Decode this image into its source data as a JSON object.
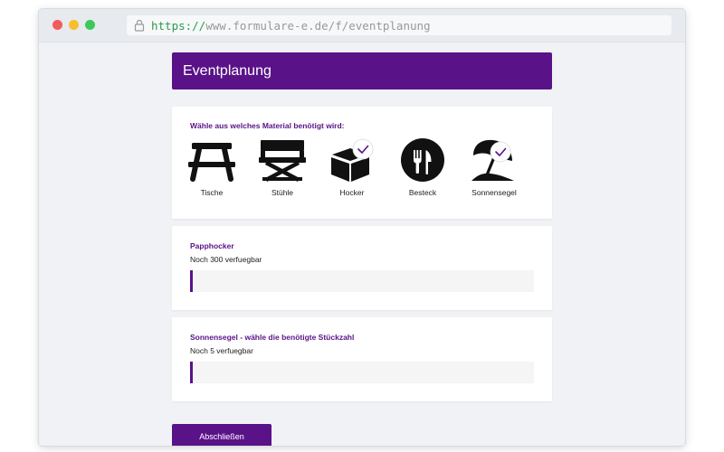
{
  "browser": {
    "url_scheme": "https://",
    "url_rest": "www.formulare-e.de/f/eventplanung"
  },
  "form": {
    "title": "Eventplanung",
    "material_label": "Wähle aus welches Material benötigt wird:",
    "materials": [
      {
        "label": "Tische",
        "icon": "picnic-table-icon",
        "selected": false
      },
      {
        "label": "Stühle",
        "icon": "director-chair-icon",
        "selected": false
      },
      {
        "label": "Hocker",
        "icon": "box-stool-icon",
        "selected": true
      },
      {
        "label": "Besteck",
        "icon": "cutlery-icon",
        "selected": false
      },
      {
        "label": "Sonnensegel",
        "icon": "beach-umbrella-icon",
        "selected": true
      }
    ],
    "papphocker": {
      "label": "Papphocker",
      "availability": "Noch 300 verfuegbar",
      "value": ""
    },
    "sonnensegel": {
      "label": "Sonnensegel - wähle die benötigte Stückzahl",
      "availability": "Noch 5 verfuegbar",
      "value": ""
    },
    "submit_label": "Abschließen"
  },
  "colors": {
    "accent": "#5a1288",
    "url_scheme": "#2d9a4e"
  }
}
